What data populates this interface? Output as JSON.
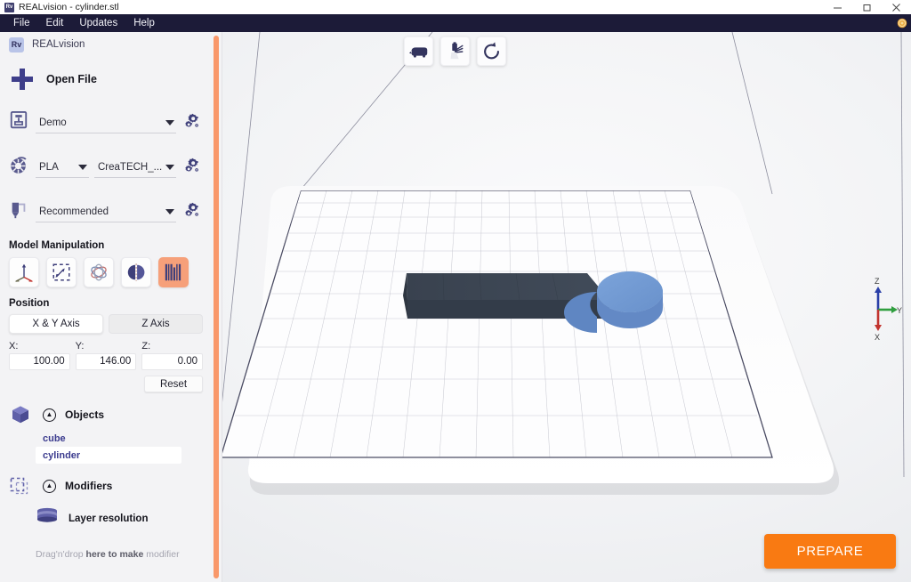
{
  "window": {
    "title": "REALvision - cylinder.stl",
    "app_badge": "Rv",
    "minimize_icon": "minimize-icon",
    "maximize_icon": "maximize-icon",
    "close_icon": "close-icon"
  },
  "menubar": {
    "items": [
      {
        "label": "File"
      },
      {
        "label": "Edit"
      },
      {
        "label": "Updates"
      },
      {
        "label": "Help"
      }
    ],
    "settings_icon": "gear-icon",
    "background_color": "#1c1b38"
  },
  "sidebar": {
    "brand": {
      "badge": "Rv",
      "name": "REALvision"
    },
    "collapse_icon": "chevron-left-icon",
    "open_file": {
      "label": "Open File",
      "icon": "plus-icon"
    },
    "selectors": [
      {
        "icon": "printer-icon",
        "value": "Demo",
        "settings_icon": "gears-icon",
        "name": "printer-selector"
      },
      {
        "icon": "filament-spool-icon",
        "value": "PLA",
        "value2": "CreaTECH_...",
        "settings_icon": "gears-icon",
        "name": "material-selector"
      },
      {
        "icon": "nozzle-icon",
        "value": "Recommended",
        "settings_icon": "gears-icon",
        "name": "profile-selector"
      }
    ],
    "model_manipulation": {
      "title": "Model Manipulation",
      "tools": [
        {
          "name": "move-tool",
          "icon": "move-axes-icon",
          "active": false
        },
        {
          "name": "scale-tool",
          "icon": "scale-box-icon",
          "active": false
        },
        {
          "name": "rotate-tool",
          "icon": "rotate-orbit-icon",
          "active": false
        },
        {
          "name": "mirror-tool",
          "icon": "mirror-icon",
          "active": false
        },
        {
          "name": "per-model-settings-tool",
          "icon": "model-settings-bars-icon",
          "active": true
        }
      ]
    },
    "position": {
      "title": "Position",
      "tabs": [
        {
          "label": "X & Y Axis",
          "active": true
        },
        {
          "label": "Z Axis",
          "active": false
        }
      ],
      "fields": [
        {
          "label": "X:",
          "value": "100.00"
        },
        {
          "label": "Y:",
          "value": "146.00"
        },
        {
          "label": "Z:",
          "value": "0.00"
        }
      ],
      "reset_label": "Reset"
    },
    "objects": {
      "title": "Objects",
      "icon": "cube-icon",
      "collapse_icon": "chevron-up-icon",
      "items": [
        {
          "label": "cube",
          "selected": false
        },
        {
          "label": "cylinder",
          "selected": true
        }
      ]
    },
    "modifiers": {
      "title": "Modifiers",
      "icon": "dashed-box-icon",
      "collapse_icon": "chevron-up-icon",
      "items": [
        {
          "label": "Layer resolution",
          "icon": "layers-icon"
        }
      ],
      "hint_prefix": "Drag'n'drop ",
      "hint_strong": "here to make ",
      "hint_suffix": "modifier"
    },
    "scrollbar_color": "#f9986a"
  },
  "viewport": {
    "toolbar": [
      {
        "name": "view-camera-button",
        "icon": "camera-view-icon"
      },
      {
        "name": "measure-button",
        "icon": "measure-tool-icon"
      },
      {
        "name": "reset-view-button",
        "icon": "refresh-rotate-icon"
      }
    ],
    "axis_gizmo": {
      "z_label": "Z",
      "z_color": "#2a3fa8",
      "y_label": "Y",
      "y_color": "#2f9e3f",
      "x_label": "X",
      "x_color": "#c2342f"
    },
    "models": [
      {
        "name": "cube",
        "color": "#3c4654",
        "shape": "box"
      },
      {
        "name": "cylinder",
        "color": "#6f9bd6",
        "shape": "cylinder"
      }
    ],
    "prepare_button": {
      "label": "PREPARE",
      "color": "#f97a12"
    }
  }
}
